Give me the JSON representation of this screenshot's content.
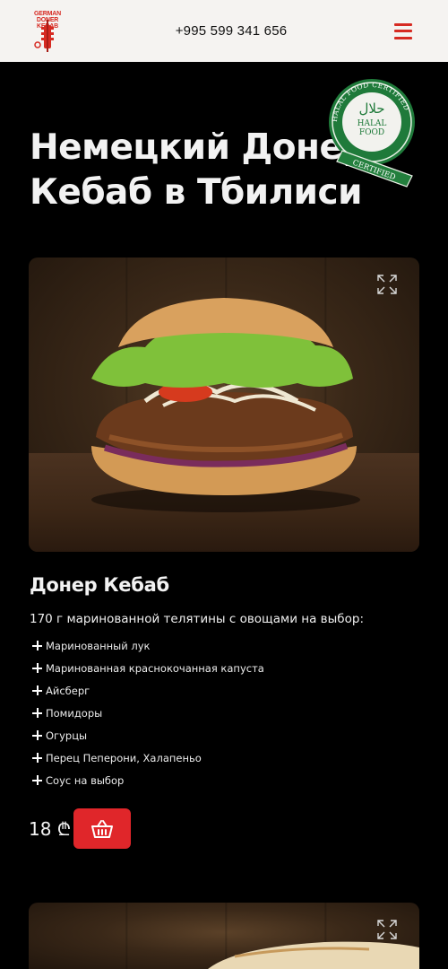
{
  "header": {
    "logo_text": "GERMAN DONER KEBAB",
    "phone": "+995 599 341 656",
    "menu_icon": "hamburger-icon"
  },
  "badge": {
    "top_text": "HALAL FOOD CERTIFIED",
    "arabic": "حلال",
    "line1": "HALAL",
    "line2": "FOOD",
    "ribbon": "CERTIFIED"
  },
  "hero": {
    "title": "Немецкий Донер Кебаб в Тбилиси"
  },
  "products": [
    {
      "title": "Донер Кебаб",
      "description": "170 г маринованной телятины с овощами на выбор:",
      "ingredients": [
        "Маринованный лук",
        "Маринованная краснокочанная капуста",
        "Айсберг",
        "Помидоры",
        "Огурцы",
        "Перец Пеперони, Халапеньо",
        "Соус на выбор"
      ],
      "price": "18 ₾",
      "cart_icon": "basket-icon",
      "expand_icon": "expand-icon"
    }
  ],
  "colors": {
    "accent": "#e0262a",
    "header_bg": "#f5f3f1",
    "page_bg": "#000000",
    "badge_green": "#1f7a3a"
  }
}
